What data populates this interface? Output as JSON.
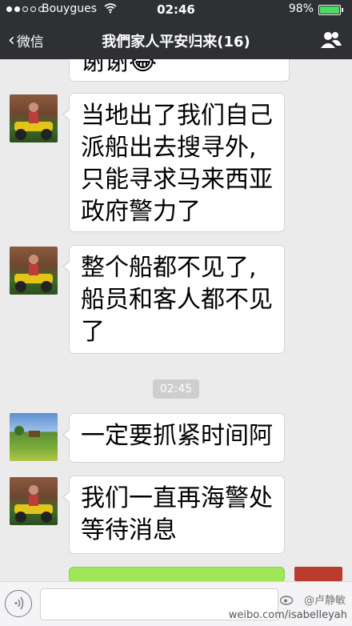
{
  "status_bar": {
    "carrier": "Bouygues",
    "time": "02:46",
    "battery": "98%",
    "battery_level": 0.98,
    "signal_dots_filled": 2,
    "signal_dots_total": 5
  },
  "nav": {
    "back_label": "微信",
    "title": "我們家人平安归来(16)"
  },
  "messages": [
    {
      "text": "谢谢😂",
      "truncated_top": true
    },
    {
      "text": "当地出了我们自己\n派船出去搜寻外,\n只能寻求马来西亚\n政府警力了"
    },
    {
      "text": "整个船都不见了,\n船员和客人都不见\n了"
    },
    {
      "text": "一定要抓紧时间阿"
    },
    {
      "text": "我们一直再海警处\n等待消息"
    }
  ],
  "timestamp": "02:45",
  "watermark": {
    "url": "weibo.com/isabelleyah",
    "handle": "@卢静敏"
  },
  "colors": {
    "header": "#2e3033",
    "chat_bg": "#ebebeb",
    "bubble": "#ffffff",
    "bubble_self": "#9fe658"
  }
}
